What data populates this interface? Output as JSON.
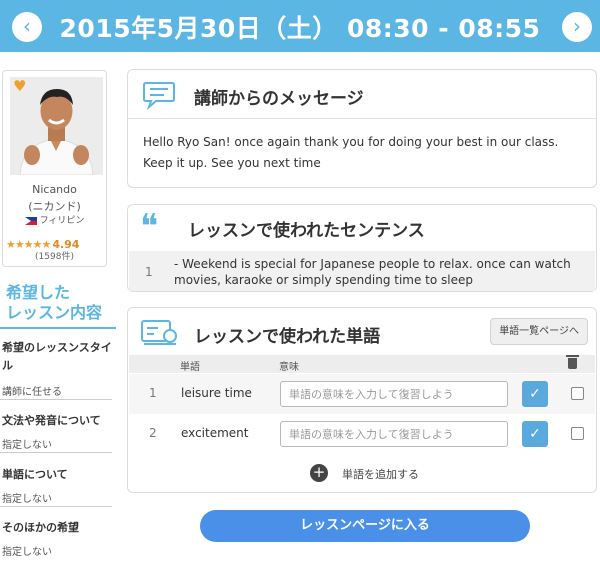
{
  "header": {
    "title": "2015年5月30日（土） 08:30 - 08:55",
    "prev_glyph": "‹",
    "next_glyph": "›"
  },
  "teacher": {
    "name": "Nicando",
    "name_kana": "(ニカンド)",
    "country": "フィリピン",
    "stars": "★★★★★",
    "rating": "4.94",
    "review_count": "(1598件)",
    "heart_glyph": "♥"
  },
  "preferences": {
    "heading": "希望した\nレッスン内容",
    "items": [
      {
        "label": "希望のレッスンスタイル",
        "value": "講師に任せる"
      },
      {
        "label": "文法や発音について",
        "value": "指定しない"
      },
      {
        "label": "単語について",
        "value": "指定しない"
      },
      {
        "label": "そのほかの希望",
        "value": "指定しない"
      }
    ]
  },
  "message": {
    "title": "講師からのメッセージ",
    "text": "Hello Ryo San! once again thank you for doing your best in our class. Keep it up. See you next time"
  },
  "sentences": {
    "title": "レッスンで使われたセンテンス",
    "quote_glyph": "❝",
    "items": [
      {
        "num": "1",
        "text": "- Weekend is special for Japanese people to relax. once can watch movies, karaoke or simply spending time to sleep"
      }
    ]
  },
  "vocab": {
    "title": "レッスンで使われた単語",
    "list_button": "単語一覧ページへ",
    "col_word": "単語",
    "col_meaning": "意味",
    "input_placeholder": "単語の意味を入力して復習しよう",
    "check_glyph": "✓",
    "add_glyph": "+",
    "rows": [
      {
        "num": "1",
        "word": "leisure time"
      },
      {
        "num": "2",
        "word": "excitement"
      }
    ],
    "add_label": "単語を追加する"
  },
  "enter_button": "レッスンページに入る",
  "colors": {
    "primary": "#5cb6e4",
    "button": "#4a90e8",
    "star": "#f0a030"
  }
}
